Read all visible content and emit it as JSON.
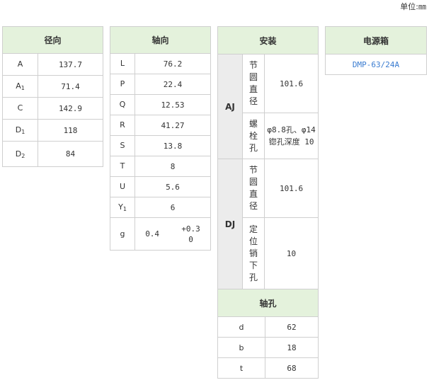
{
  "unit_label": "单位:㎜",
  "radial": {
    "title": "径向",
    "rows": [
      {
        "sym": "A",
        "sub": "",
        "val": "137.7"
      },
      {
        "sym": "A",
        "sub": "1",
        "val": "71.4"
      },
      {
        "sym": "C",
        "sub": "",
        "val": "142.9"
      },
      {
        "sym": "D",
        "sub": "1",
        "val": "118"
      },
      {
        "sym": "D",
        "sub": "2",
        "val": "84"
      }
    ]
  },
  "axial": {
    "title": "轴向",
    "rows": [
      {
        "sym": "L",
        "sub": "",
        "val": "76.2"
      },
      {
        "sym": "P",
        "sub": "",
        "val": "22.4"
      },
      {
        "sym": "Q",
        "sub": "",
        "val": "12.53"
      },
      {
        "sym": "R",
        "sub": "",
        "val": "41.27"
      },
      {
        "sym": "S",
        "sub": "",
        "val": "13.8"
      },
      {
        "sym": "T",
        "sub": "",
        "val": "8"
      },
      {
        "sym": "U",
        "sub": "",
        "val": "5.6"
      },
      {
        "sym": "Y",
        "sub": "1",
        "val": "6"
      }
    ],
    "g_row": {
      "sym": "g",
      "val": "0.4",
      "tol_upper": "+0.3",
      "tol_lower": "0"
    }
  },
  "mounting": {
    "title": "安装",
    "groups": [
      {
        "label": "AJ",
        "items": [
          {
            "name": "节圆直径",
            "value": "101.6"
          },
          {
            "name": "螺栓孔",
            "value": "φ8.8孔、φ14锪孔深度 10"
          }
        ]
      },
      {
        "label": "DJ",
        "items": [
          {
            "name": "节圆直径",
            "value": "101.6"
          },
          {
            "name": "定位销下孔",
            "value": "10"
          }
        ]
      }
    ]
  },
  "shaft_hole": {
    "title": "轴孔",
    "rows": [
      {
        "sym": "d",
        "val": "62"
      },
      {
        "sym": "b",
        "val": "18"
      },
      {
        "sym": "t",
        "val": "68"
      }
    ]
  },
  "power_box": {
    "title": "电源箱",
    "model": "DMP-63/24A"
  }
}
